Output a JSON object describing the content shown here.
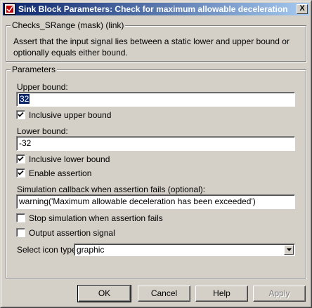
{
  "window": {
    "title": "Sink Block Parameters: Check for maximum allowable deceleration",
    "close_glyph": "X"
  },
  "description_group": {
    "legend": "Checks_SRange (mask) (link)",
    "text": "Assert that the input signal lies between a static lower and upper bound or optionally equals either bound."
  },
  "parameters_group": {
    "legend": "Parameters",
    "upper_bound_label": "Upper bound:",
    "upper_bound_value": "32",
    "inclusive_upper_label": "Inclusive upper bound",
    "inclusive_upper_checked": true,
    "lower_bound_label": "Lower bound:",
    "lower_bound_value": "-32",
    "inclusive_lower_label": "Inclusive lower bound",
    "inclusive_lower_checked": true,
    "enable_assertion_label": "Enable assertion",
    "enable_assertion_checked": true,
    "callback_label": "Simulation callback when assertion fails (optional):",
    "callback_value": "warning('Maximum allowable deceleration has been exceeded')",
    "stop_simulation_label": "Stop simulation when assertion fails",
    "stop_simulation_checked": false,
    "output_signal_label": "Output assertion signal",
    "output_signal_checked": false,
    "icon_type_label": "Select icon type:",
    "icon_type_value": "graphic"
  },
  "buttons": {
    "ok": "OK",
    "cancel": "Cancel",
    "help": "Help",
    "apply": "Apply"
  }
}
